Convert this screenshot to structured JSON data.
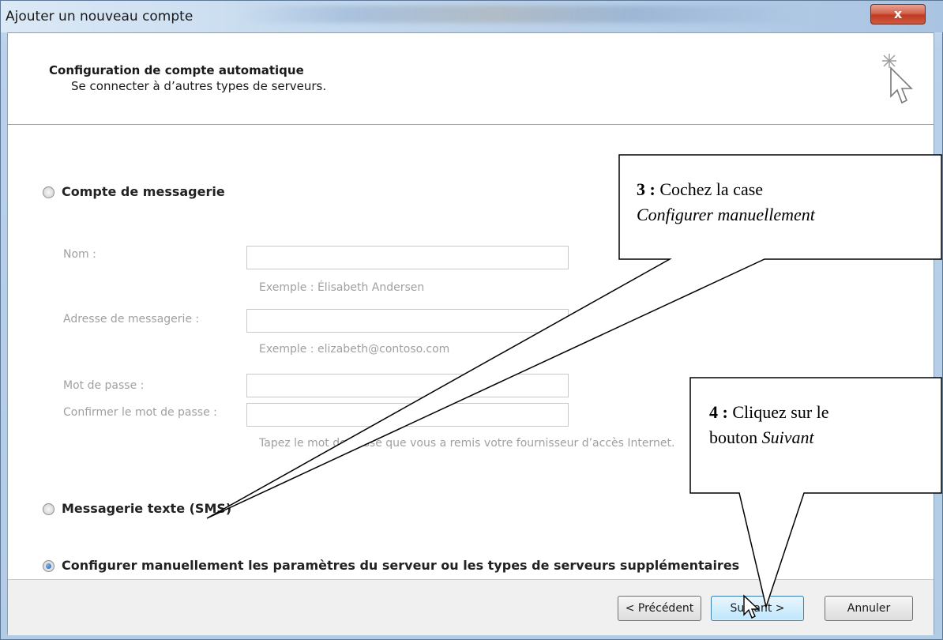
{
  "window": {
    "title": "Ajouter un nouveau compte",
    "close_label": "x"
  },
  "header": {
    "title": "Configuration de compte automatique",
    "subtitle": "Se connecter à d’autres types de serveurs.",
    "icon": "cursor-sparkle-icon"
  },
  "options": {
    "email": {
      "label": "Compte de messagerie",
      "checked": false
    },
    "sms": {
      "label": "Messagerie texte (SMS)",
      "checked": false
    },
    "manual": {
      "label": "Configurer manuellement les paramètres du serveur ou les types de serveurs supplémentaires",
      "checked": true
    }
  },
  "form": {
    "name": {
      "label": "Nom :",
      "value": "",
      "hint": "Exemple : Élisabeth Andersen"
    },
    "email": {
      "label": "Adresse de messagerie :",
      "value": "",
      "hint": "Exemple : elizabeth@contoso.com"
    },
    "password": {
      "label": "Mot de passe :",
      "value": ""
    },
    "confirm": {
      "label": "Confirmer le mot de passe :",
      "value": "",
      "hint": "Tapez le mot de passe que vous a remis votre fournisseur d’accès Internet."
    }
  },
  "buttons": {
    "back": "< Précédent",
    "next": "Suivant >",
    "cancel": "Annuler"
  },
  "callouts": {
    "step3": {
      "number": "3 :",
      "text": "Cochez la case",
      "emphasis": "Configurer manuellement"
    },
    "step4": {
      "number": "4 :",
      "text": "Cliquez sur le",
      "text2": "bouton",
      "emphasis": "Suivant"
    }
  },
  "colors": {
    "close_button": "#c94a32",
    "radio_checked": "#1a5fb0",
    "disabled_text": "#a0a0a0"
  }
}
